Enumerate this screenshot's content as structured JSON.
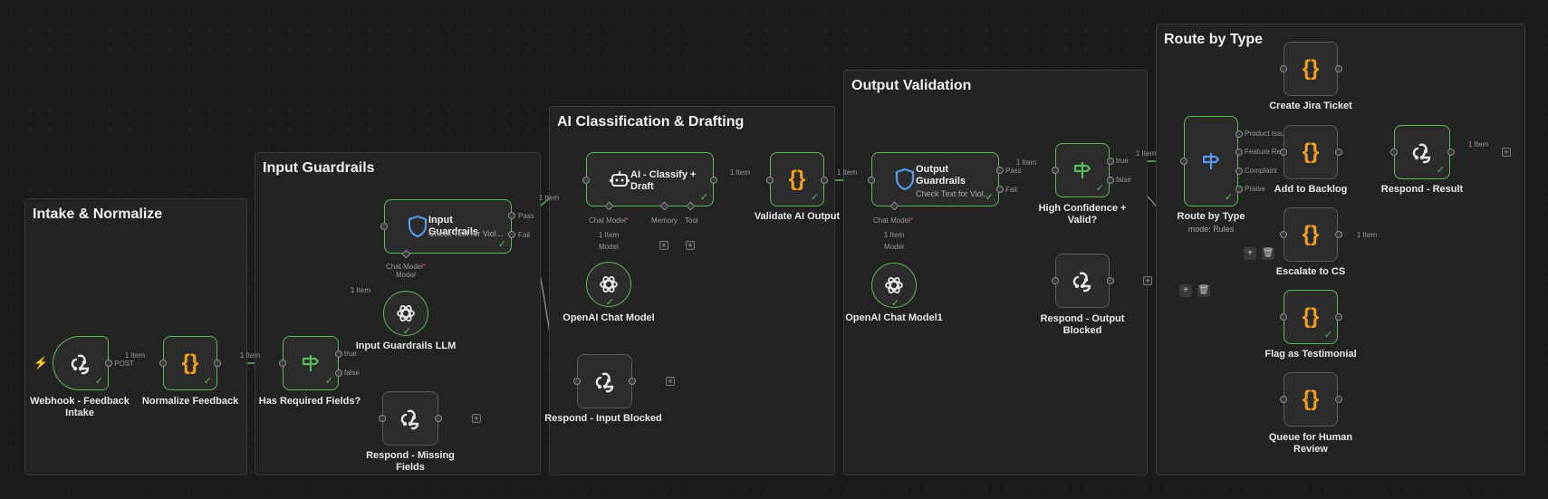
{
  "groups": {
    "intake": "Intake & Normalize",
    "input_guardrails": "Input Guardrails",
    "ai": "AI Classification & Drafting",
    "output": "Output Validation",
    "route": "Route by Type"
  },
  "nodes": {
    "webhook": "Webhook - Feedback Intake",
    "normalize": "Normalize Feedback",
    "has_required": "Has Required Fields?",
    "respond_missing": "Respond - Missing Fields",
    "input_guardrails": {
      "title": "Input Guardrails",
      "subtitle": "Check Text for Viol..."
    },
    "input_guardrails_llm": "Input Guardrails LLM",
    "respond_input_blocked": "Respond - Input Blocked",
    "ai_classify": "AI - Classify + Draft",
    "openai_model": "OpenAI Chat Model",
    "validate_ai": "Validate AI Output",
    "output_guardrails": {
      "title": "Output Guardrails",
      "subtitle": "Check Text for Viol..."
    },
    "openai_model1": "OpenAI Chat Model1",
    "high_confidence": "High Confidence + Valid?",
    "respond_output_blocked": "Respond - Output Blocked",
    "route_by_type": "Route by Type",
    "route_by_type_mode": "mode: Rules",
    "create_jira": "Create Jira Ticket",
    "add_backlog": "Add to Backlog",
    "escalate_cs": "Escalate to CS",
    "flag_testimonial": "Flag as Testimonial",
    "queue_review": "Queue for Human Review",
    "respond_result": "Respond - Result"
  },
  "ports": {
    "true": "true",
    "false": "false",
    "pass": "Pass",
    "fail": "Fail",
    "chat_model": "Chat Model",
    "required_mark": "*",
    "model": "Model",
    "memory": "Memory",
    "tool": "Tool",
    "product_issue": "Product Issue",
    "feature_request": "Feature Request",
    "complaint": "Complaint",
    "praise": "Praise"
  },
  "edges": {
    "one_item": "1 Item",
    "post": "POST"
  },
  "controls": {
    "plus": "+",
    "trash": "🗑"
  },
  "colors": {
    "success": "#5cb85c",
    "code_icon": "#f0a020",
    "guard_icon": "#5a9ae8",
    "bolt": "#e0603a"
  }
}
